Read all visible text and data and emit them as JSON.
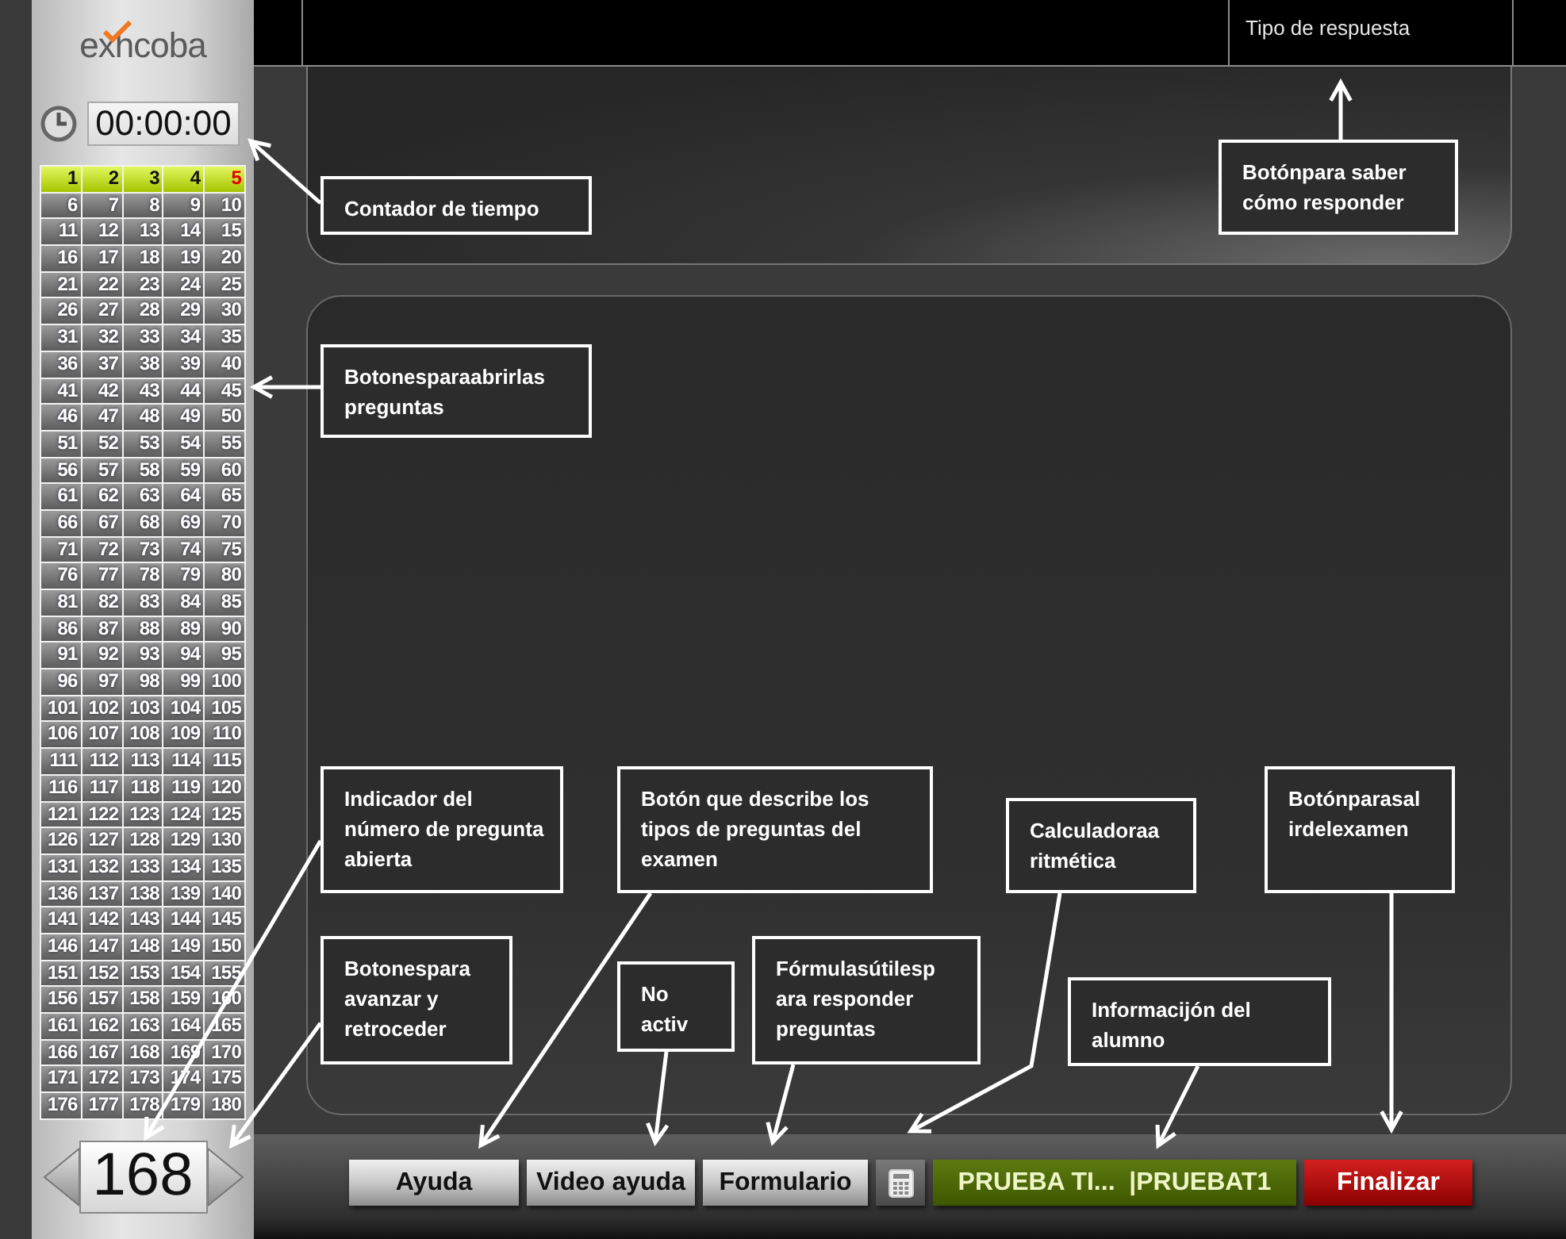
{
  "sidebar": {
    "logo": "exhcoba",
    "timer": "00:00:00",
    "questions": [
      {
        "label": "1",
        "visited": true,
        "selected": false
      },
      {
        "label": "2",
        "visited": true,
        "selected": false
      },
      {
        "label": "3",
        "visited": true,
        "selected": false
      },
      {
        "label": "4",
        "visited": true,
        "selected": false
      },
      {
        "label": "5",
        "visited": true,
        "selected": true
      },
      {
        "label": "6",
        "visited": false,
        "selected": false
      },
      {
        "label": "7",
        "visited": false,
        "selected": false
      },
      {
        "label": "8",
        "visited": false,
        "selected": false
      },
      {
        "label": "9",
        "visited": false,
        "selected": false
      },
      {
        "label": "10",
        "visited": false,
        "selected": false
      },
      {
        "label": "11",
        "visited": false,
        "selected": false
      },
      {
        "label": "12",
        "visited": false,
        "selected": false
      },
      {
        "label": "13",
        "visited": false,
        "selected": false
      },
      {
        "label": "14",
        "visited": false,
        "selected": false
      },
      {
        "label": "15",
        "visited": false,
        "selected": false
      },
      {
        "label": "16",
        "visited": false,
        "selected": false
      },
      {
        "label": "17",
        "visited": false,
        "selected": false
      },
      {
        "label": "18",
        "visited": false,
        "selected": false
      },
      {
        "label": "19",
        "visited": false,
        "selected": false
      },
      {
        "label": "20",
        "visited": false,
        "selected": false
      },
      {
        "label": "21",
        "visited": false,
        "selected": false
      },
      {
        "label": "22",
        "visited": false,
        "selected": false
      },
      {
        "label": "23",
        "visited": false,
        "selected": false
      },
      {
        "label": "24",
        "visited": false,
        "selected": false
      },
      {
        "label": "25",
        "visited": false,
        "selected": false
      },
      {
        "label": "26",
        "visited": false,
        "selected": false
      },
      {
        "label": "27",
        "visited": false,
        "selected": false
      },
      {
        "label": "28",
        "visited": false,
        "selected": false
      },
      {
        "label": "29",
        "visited": false,
        "selected": false
      },
      {
        "label": "30",
        "visited": false,
        "selected": false
      },
      {
        "label": "31",
        "visited": false,
        "selected": false
      },
      {
        "label": "32",
        "visited": false,
        "selected": false
      },
      {
        "label": "33",
        "visited": false,
        "selected": false
      },
      {
        "label": "34",
        "visited": false,
        "selected": false
      },
      {
        "label": "35",
        "visited": false,
        "selected": false
      },
      {
        "label": "36",
        "visited": false,
        "selected": false
      },
      {
        "label": "37",
        "visited": false,
        "selected": false
      },
      {
        "label": "38",
        "visited": false,
        "selected": false
      },
      {
        "label": "39",
        "visited": false,
        "selected": false
      },
      {
        "label": "40",
        "visited": false,
        "selected": false
      },
      {
        "label": "41",
        "visited": false,
        "selected": false
      },
      {
        "label": "42",
        "visited": false,
        "selected": false
      },
      {
        "label": "43",
        "visited": false,
        "selected": false
      },
      {
        "label": "44",
        "visited": false,
        "selected": false
      },
      {
        "label": "45",
        "visited": false,
        "selected": false
      },
      {
        "label": "46",
        "visited": false,
        "selected": false
      },
      {
        "label": "47",
        "visited": false,
        "selected": false
      },
      {
        "label": "48",
        "visited": false,
        "selected": false
      },
      {
        "label": "49",
        "visited": false,
        "selected": false
      },
      {
        "label": "50",
        "visited": false,
        "selected": false
      },
      {
        "label": "51",
        "visited": false,
        "selected": false
      },
      {
        "label": "52",
        "visited": false,
        "selected": false
      },
      {
        "label": "53",
        "visited": false,
        "selected": false
      },
      {
        "label": "54",
        "visited": false,
        "selected": false
      },
      {
        "label": "55",
        "visited": false,
        "selected": false
      },
      {
        "label": "56",
        "visited": false,
        "selected": false
      },
      {
        "label": "57",
        "visited": false,
        "selected": false
      },
      {
        "label": "58",
        "visited": false,
        "selected": false
      },
      {
        "label": "59",
        "visited": false,
        "selected": false
      },
      {
        "label": "60",
        "visited": false,
        "selected": false
      },
      {
        "label": "61",
        "visited": false,
        "selected": false
      },
      {
        "label": "62",
        "visited": false,
        "selected": false
      },
      {
        "label": "63",
        "visited": false,
        "selected": false
      },
      {
        "label": "64",
        "visited": false,
        "selected": false
      },
      {
        "label": "65",
        "visited": false,
        "selected": false
      },
      {
        "label": "66",
        "visited": false,
        "selected": false
      },
      {
        "label": "67",
        "visited": false,
        "selected": false
      },
      {
        "label": "68",
        "visited": false,
        "selected": false
      },
      {
        "label": "69",
        "visited": false,
        "selected": false
      },
      {
        "label": "70",
        "visited": false,
        "selected": false
      },
      {
        "label": "71",
        "visited": false,
        "selected": false
      },
      {
        "label": "72",
        "visited": false,
        "selected": false
      },
      {
        "label": "73",
        "visited": false,
        "selected": false
      },
      {
        "label": "74",
        "visited": false,
        "selected": false
      },
      {
        "label": "75",
        "visited": false,
        "selected": false
      },
      {
        "label": "76",
        "visited": false,
        "selected": false
      },
      {
        "label": "77",
        "visited": false,
        "selected": false
      },
      {
        "label": "78",
        "visited": false,
        "selected": false
      },
      {
        "label": "79",
        "visited": false,
        "selected": false
      },
      {
        "label": "80",
        "visited": false,
        "selected": false
      },
      {
        "label": "81",
        "visited": false,
        "selected": false
      },
      {
        "label": "82",
        "visited": false,
        "selected": false
      },
      {
        "label": "83",
        "visited": false,
        "selected": false
      },
      {
        "label": "84",
        "visited": false,
        "selected": false
      },
      {
        "label": "85",
        "visited": false,
        "selected": false
      },
      {
        "label": "86",
        "visited": false,
        "selected": false
      },
      {
        "label": "87",
        "visited": false,
        "selected": false
      },
      {
        "label": "88",
        "visited": false,
        "selected": false
      },
      {
        "label": "89",
        "visited": false,
        "selected": false
      },
      {
        "label": "90",
        "visited": false,
        "selected": false
      },
      {
        "label": "91",
        "visited": false,
        "selected": false
      },
      {
        "label": "92",
        "visited": false,
        "selected": false
      },
      {
        "label": "93",
        "visited": false,
        "selected": false
      },
      {
        "label": "94",
        "visited": false,
        "selected": false
      },
      {
        "label": "95",
        "visited": false,
        "selected": false
      },
      {
        "label": "96",
        "visited": false,
        "selected": false
      },
      {
        "label": "97",
        "visited": false,
        "selected": false
      },
      {
        "label": "98",
        "visited": false,
        "selected": false
      },
      {
        "label": "99",
        "visited": false,
        "selected": false
      },
      {
        "label": "100",
        "visited": false,
        "selected": false
      },
      {
        "label": "101",
        "visited": false,
        "selected": false
      },
      {
        "label": "102",
        "visited": false,
        "selected": false
      },
      {
        "label": "103",
        "visited": false,
        "selected": false
      },
      {
        "label": "104",
        "visited": false,
        "selected": false
      },
      {
        "label": "105",
        "visited": false,
        "selected": false
      },
      {
        "label": "106",
        "visited": false,
        "selected": false
      },
      {
        "label": "107",
        "visited": false,
        "selected": false
      },
      {
        "label": "108",
        "visited": false,
        "selected": false
      },
      {
        "label": "109",
        "visited": false,
        "selected": false
      },
      {
        "label": "110",
        "visited": false,
        "selected": false
      },
      {
        "label": "111",
        "visited": false,
        "selected": false
      },
      {
        "label": "112",
        "visited": false,
        "selected": false
      },
      {
        "label": "113",
        "visited": false,
        "selected": false
      },
      {
        "label": "114",
        "visited": false,
        "selected": false
      },
      {
        "label": "115",
        "visited": false,
        "selected": false
      },
      {
        "label": "116",
        "visited": false,
        "selected": false
      },
      {
        "label": "117",
        "visited": false,
        "selected": false
      },
      {
        "label": "118",
        "visited": false,
        "selected": false
      },
      {
        "label": "119",
        "visited": false,
        "selected": false
      },
      {
        "label": "120",
        "visited": false,
        "selected": false
      },
      {
        "label": "121",
        "visited": false,
        "selected": false
      },
      {
        "label": "122",
        "visited": false,
        "selected": false
      },
      {
        "label": "123",
        "visited": false,
        "selected": false
      },
      {
        "label": "124",
        "visited": false,
        "selected": false
      },
      {
        "label": "125",
        "visited": false,
        "selected": false
      },
      {
        "label": "126",
        "visited": false,
        "selected": false
      },
      {
        "label": "127",
        "visited": false,
        "selected": false
      },
      {
        "label": "128",
        "visited": false,
        "selected": false
      },
      {
        "label": "129",
        "visited": false,
        "selected": false
      },
      {
        "label": "130",
        "visited": false,
        "selected": false
      },
      {
        "label": "131",
        "visited": false,
        "selected": false
      },
      {
        "label": "132",
        "visited": false,
        "selected": false
      },
      {
        "label": "133",
        "visited": false,
        "selected": false
      },
      {
        "label": "134",
        "visited": false,
        "selected": false
      },
      {
        "label": "135",
        "visited": false,
        "selected": false
      },
      {
        "label": "136",
        "visited": false,
        "selected": false
      },
      {
        "label": "137",
        "visited": false,
        "selected": false
      },
      {
        "label": "138",
        "visited": false,
        "selected": false
      },
      {
        "label": "139",
        "visited": false,
        "selected": false
      },
      {
        "label": "140",
        "visited": false,
        "selected": false
      },
      {
        "label": "141",
        "visited": false,
        "selected": false
      },
      {
        "label": "142",
        "visited": false,
        "selected": false
      },
      {
        "label": "143",
        "visited": false,
        "selected": false
      },
      {
        "label": "144",
        "visited": false,
        "selected": false
      },
      {
        "label": "145",
        "visited": false,
        "selected": false
      },
      {
        "label": "146",
        "visited": false,
        "selected": false
      },
      {
        "label": "147",
        "visited": false,
        "selected": false
      },
      {
        "label": "148",
        "visited": false,
        "selected": false
      },
      {
        "label": "149",
        "visited": false,
        "selected": false
      },
      {
        "label": "150",
        "visited": false,
        "selected": false
      },
      {
        "label": "151",
        "visited": false,
        "selected": false
      },
      {
        "label": "152",
        "visited": false,
        "selected": false
      },
      {
        "label": "153",
        "visited": false,
        "selected": false
      },
      {
        "label": "154",
        "visited": false,
        "selected": false
      },
      {
        "label": "155",
        "visited": false,
        "selected": false
      },
      {
        "label": "156",
        "visited": false,
        "selected": false
      },
      {
        "label": "157",
        "visited": false,
        "selected": false
      },
      {
        "label": "158",
        "visited": false,
        "selected": false
      },
      {
        "label": "159",
        "visited": false,
        "selected": false
      },
      {
        "label": "160",
        "visited": false,
        "selected": false
      },
      {
        "label": "161",
        "visited": false,
        "selected": false
      },
      {
        "label": "162",
        "visited": false,
        "selected": false
      },
      {
        "label": "163",
        "visited": false,
        "selected": false
      },
      {
        "label": "164",
        "visited": false,
        "selected": false
      },
      {
        "label": "165",
        "visited": false,
        "selected": false
      },
      {
        "label": "166",
        "visited": false,
        "selected": false
      },
      {
        "label": "167",
        "visited": false,
        "selected": false
      },
      {
        "label": "168",
        "visited": false,
        "selected": false
      },
      {
        "label": "169",
        "visited": false,
        "selected": false
      },
      {
        "label": "170",
        "visited": false,
        "selected": false
      },
      {
        "label": "171",
        "visited": false,
        "selected": false
      },
      {
        "label": "172",
        "visited": false,
        "selected": false
      },
      {
        "label": "173",
        "visited": false,
        "selected": false
      },
      {
        "label": "174",
        "visited": false,
        "selected": false
      },
      {
        "label": "175",
        "visited": false,
        "selected": false
      },
      {
        "label": "176",
        "visited": false,
        "selected": false
      },
      {
        "label": "177",
        "visited": false,
        "selected": false
      },
      {
        "label": "178",
        "visited": false,
        "selected": false
      },
      {
        "label": "179",
        "visited": false,
        "selected": false
      },
      {
        "label": "180",
        "visited": false,
        "selected": false
      }
    ],
    "question_number": "168"
  },
  "header": {
    "answer_type_button": "Tipo de respuesta"
  },
  "toolbar": [
    {
      "kind": "button",
      "label": "Ayuda"
    },
    {
      "kind": "button",
      "label": "Video ayuda"
    },
    {
      "kind": "button",
      "label": "Formulario"
    },
    {
      "kind": "calculator"
    },
    {
      "kind": "info",
      "label": "PRUEBA TI...  |PRUEBAT1"
    },
    {
      "kind": "danger",
      "label": "Finalizar"
    }
  ],
  "annotations": [
    {
      "text": "Contador de tiempo"
    },
    {
      "text": "Botónpara saber cómo responder"
    },
    {
      "text": "Botonesparaabrirlas preguntas"
    },
    {
      "text": "Indicador del número de pregunta abierta"
    },
    {
      "text": "Botonespara avanzar y retroceder"
    },
    {
      "text": "Botón que describe los tipos de preguntas del examen"
    },
    {
      "text": "No activ"
    },
    {
      "text": "Fórmulasútilesp ara responder preguntas"
    },
    {
      "text": "Calculadoraa ritmética"
    },
    {
      "text": "Informacijón del alumno"
    },
    {
      "text": "Botónparasal irdelexamen"
    }
  ]
}
